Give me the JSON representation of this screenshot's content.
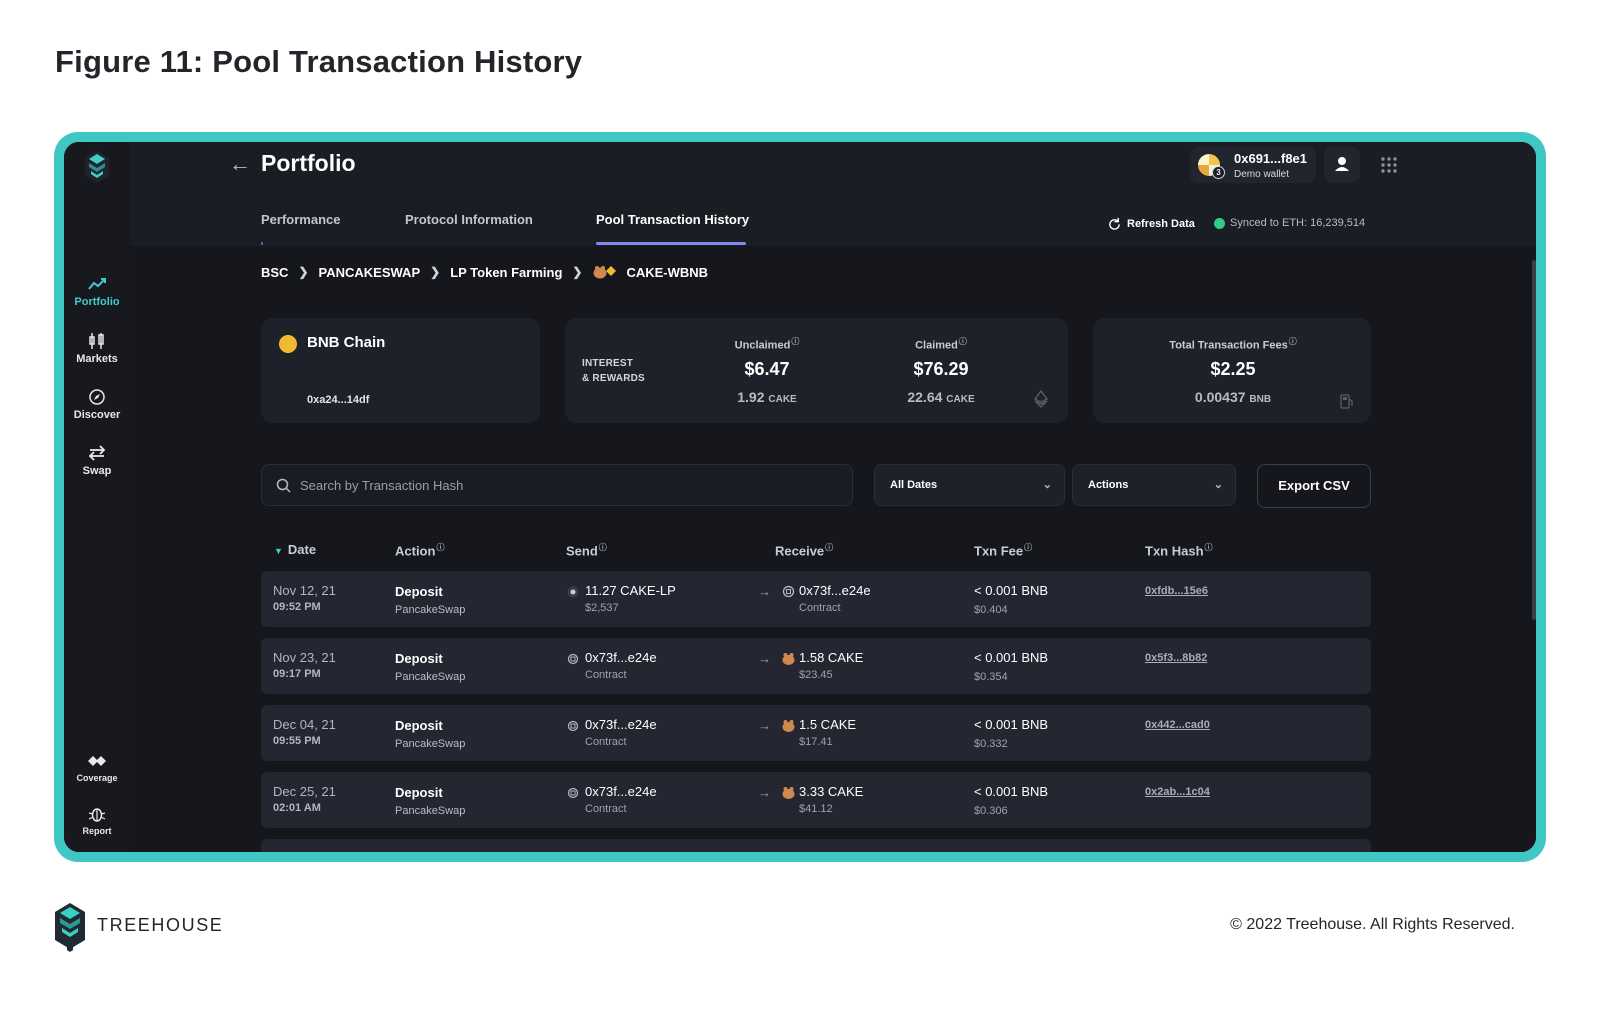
{
  "figure_title": "Figure 11: Pool Transaction History",
  "sidebar": {
    "items": [
      {
        "label": "Portfolio",
        "icon": "trend-chart-icon",
        "active": true
      },
      {
        "label": "Markets",
        "icon": "candlestick-icon"
      },
      {
        "label": "Discover",
        "icon": "compass-icon"
      },
      {
        "label": "Swap",
        "icon": "swap-arrows-icon"
      }
    ],
    "bottom_items": [
      {
        "label": "Coverage",
        "icon": "coverage-icon"
      },
      {
        "label": "Report",
        "icon": "bug-icon"
      }
    ]
  },
  "header": {
    "title": "Portfolio",
    "wallet_address": "0x691...f8e1",
    "wallet_label": "Demo wallet",
    "wallet_badge": "3"
  },
  "tabs": [
    {
      "label": "Performance"
    },
    {
      "label": "Protocol Information"
    },
    {
      "label": "Pool Transaction History",
      "active": true
    }
  ],
  "sync": {
    "refresh_label": "Refresh Data",
    "status": "Synced to ETH: 16,239,514"
  },
  "breadcrumb": [
    "BSC",
    "PANCAKESWAP",
    "LP Token Farming",
    "CAKE-WBNB"
  ],
  "chain_card": {
    "name": "BNB Chain",
    "address": "0xa24...14df"
  },
  "rewards_card": {
    "label_line1": "INTEREST",
    "label_line2": "& REWARDS",
    "unclaimed_label": "Unclaimed",
    "unclaimed_usd": "$6.47",
    "unclaimed_amount": "1.92",
    "unclaimed_unit": "CAKE",
    "claimed_label": "Claimed",
    "claimed_usd": "$76.29",
    "claimed_amount": "22.64",
    "claimed_unit": "CAKE"
  },
  "fees_card": {
    "label": "Total Transaction Fees",
    "usd": "$2.25",
    "amount": "0.00437",
    "unit": "BNB"
  },
  "filters": {
    "search_placeholder": "Search by Transaction Hash",
    "dates_label": "All Dates",
    "actions_label": "Actions",
    "export_label": "Export CSV"
  },
  "table": {
    "headers": [
      "Date",
      "Action",
      "Send",
      "Receive",
      "Txn Fee",
      "Txn Hash"
    ],
    "rows": [
      {
        "date": "Nov 12, 21",
        "time": "09:52 PM",
        "action": "Deposit",
        "protocol": "PancakeSwap",
        "send": "11.27 CAKE-LP",
        "send_sub": "$2,537",
        "send_icon": "lp-token-icon",
        "receive": "0x73f...e24e",
        "receive_sub": "Contract",
        "receive_icon": "contract-icon",
        "fee": "< 0.001 BNB",
        "fee_usd": "$0.404",
        "hash": "0xfdb...15e6"
      },
      {
        "date": "Nov 23, 21",
        "time": "09:17 PM",
        "action": "Deposit",
        "protocol": "PancakeSwap",
        "send": "0x73f...e24e",
        "send_sub": "Contract",
        "send_icon": "contract-icon",
        "receive": "1.58 CAKE",
        "receive_sub": "$23.45",
        "receive_icon": "cake-icon",
        "fee": "< 0.001 BNB",
        "fee_usd": "$0.354",
        "hash": "0x5f3...8b82"
      },
      {
        "date": "Dec 04, 21",
        "time": "09:55 PM",
        "action": "Deposit",
        "protocol": "PancakeSwap",
        "send": "0x73f...e24e",
        "send_sub": "Contract",
        "send_icon": "contract-icon",
        "receive": "1.5 CAKE",
        "receive_sub": "$17.41",
        "receive_icon": "cake-icon",
        "fee": "< 0.001 BNB",
        "fee_usd": "$0.332",
        "hash": "0x442...cad0"
      },
      {
        "date": "Dec 25, 21",
        "time": "02:01 AM",
        "action": "Deposit",
        "protocol": "PancakeSwap",
        "send": "0x73f...e24e",
        "send_sub": "Contract",
        "send_icon": "contract-icon",
        "receive": "3.33 CAKE",
        "receive_sub": "$41.12",
        "receive_icon": "cake-icon",
        "fee": "< 0.001 BNB",
        "fee_usd": "$0.306",
        "hash": "0x2ab...1c04"
      }
    ]
  },
  "footer": {
    "brand": "TREEHOUSE",
    "copyright": "© 2022 Treehouse. All Rights Reserved."
  },
  "colors": {
    "frame": "#3fc7c4",
    "accent": "#3ccfc7",
    "tab_underline": "#7e8cf0",
    "app_bg": "#1b1d24",
    "synced_ok": "#33c98a"
  }
}
